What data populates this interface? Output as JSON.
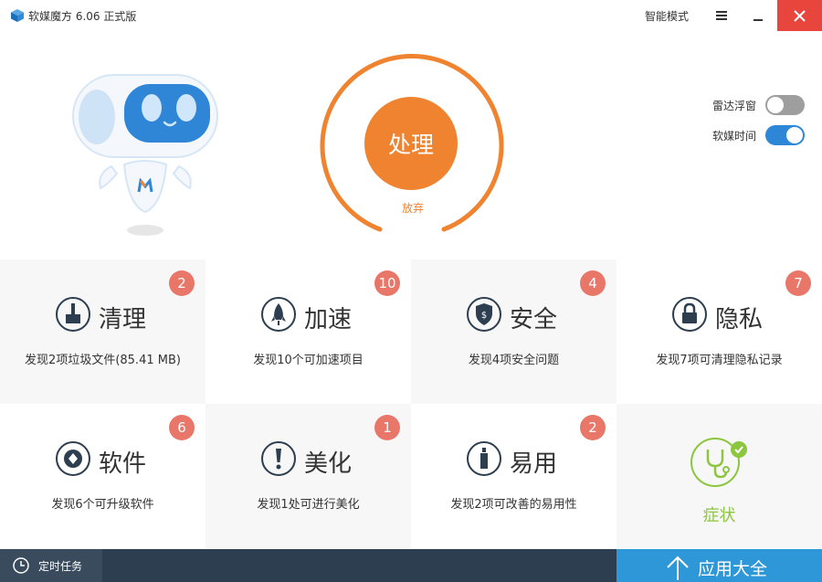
{
  "titlebar": {
    "title": "软媒魔方 6.06 正式版",
    "mode_label": "智能模式"
  },
  "hero": {
    "process_label": "处理",
    "abandon_label": "放弃",
    "toggles": [
      {
        "label": "雷达浮窗",
        "on": false
      },
      {
        "label": "软媒时间",
        "on": true
      }
    ]
  },
  "tiles": [
    {
      "title": "清理",
      "desc": "发现2项垃圾文件(85.41 MB)",
      "badge": "2",
      "icon": "broom-icon"
    },
    {
      "title": "加速",
      "desc": "发现10个可加速项目",
      "badge": "10",
      "icon": "rocket-icon"
    },
    {
      "title": "安全",
      "desc": "发现4项安全问题",
      "badge": "4",
      "icon": "shield-icon"
    },
    {
      "title": "隐私",
      "desc": "发现7项可清理隐私记录",
      "badge": "7",
      "icon": "lock-icon"
    },
    {
      "title": "软件",
      "desc": "发现6个可升级软件",
      "badge": "6",
      "icon": "aperture-icon"
    },
    {
      "title": "美化",
      "desc": "发现1处可进行美化",
      "badge": "1",
      "icon": "exclamation-icon"
    },
    {
      "title": "易用",
      "desc": "发现2项可改善的易用性",
      "badge": "2",
      "icon": "bottle-icon"
    }
  ],
  "symptom": {
    "label": "症状",
    "icon": "stethoscope-icon"
  },
  "bottombar": {
    "schedule_label": "定时任务",
    "apps_label": "应用大全"
  },
  "colors": {
    "accent_orange": "#f08330",
    "badge_red": "#e8776a",
    "toggle_blue": "#2e86d6",
    "bottom_dark": "#2d3e50",
    "apps_blue": "#2e97d8",
    "symptom_green": "#8cc63e",
    "close_red": "#e8453c"
  }
}
